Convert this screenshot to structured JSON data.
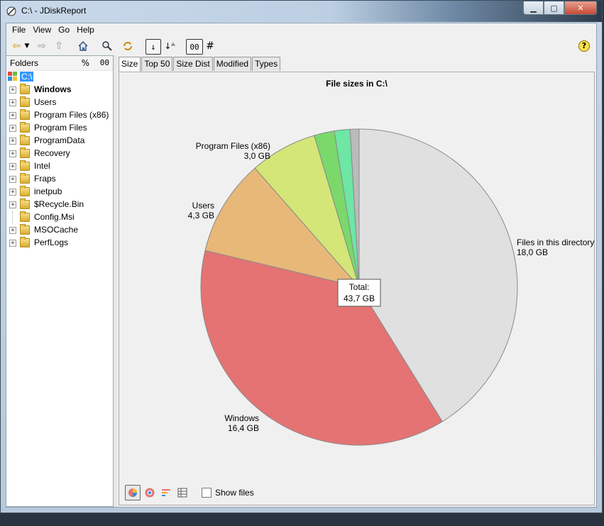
{
  "window": {
    "title": "C:\\ - JDiskReport"
  },
  "menu": [
    "File",
    "View",
    "Go",
    "Help"
  ],
  "toolbar": {
    "mode_label": "00",
    "count_label": "#"
  },
  "folders": {
    "header": "Folders",
    "pct_label": "%",
    "mode_label": "00",
    "root": "C:\\",
    "items": [
      {
        "label": "Windows",
        "bold": true,
        "expandable": true
      },
      {
        "label": "Users",
        "bold": false,
        "expandable": true
      },
      {
        "label": "Program Files (x86)",
        "bold": false,
        "expandable": true
      },
      {
        "label": "Program Files",
        "bold": false,
        "expandable": true
      },
      {
        "label": "ProgramData",
        "bold": false,
        "expandable": true
      },
      {
        "label": "Recovery",
        "bold": false,
        "expandable": true
      },
      {
        "label": "Intel",
        "bold": false,
        "expandable": true
      },
      {
        "label": "Fraps",
        "bold": false,
        "expandable": true
      },
      {
        "label": "inetpub",
        "bold": false,
        "expandable": true
      },
      {
        "label": "$Recycle.Bin",
        "bold": false,
        "expandable": true
      },
      {
        "label": "Config.Msi",
        "bold": false,
        "expandable": false
      },
      {
        "label": "MSOCache",
        "bold": false,
        "expandable": true
      },
      {
        "label": "PerfLogs",
        "bold": false,
        "expandable": true
      }
    ]
  },
  "tabs": [
    "Size",
    "Top 50",
    "Size Dist",
    "Modified",
    "Types"
  ],
  "active_tab": "Size",
  "bottom": {
    "show_files_label": "Show files",
    "show_files_checked": false
  },
  "chart_data": {
    "type": "pie",
    "title": "File sizes in C:\\",
    "total_label": "Total:",
    "total_value": "43,7 GB",
    "slices": [
      {
        "name": "Files in this directory",
        "value": 18.0,
        "value_label": "18,0 GB",
        "color": "#e0e0e0",
        "labeled": true
      },
      {
        "name": "Windows",
        "value": 16.4,
        "value_label": "16,4 GB",
        "color": "#e57373",
        "labeled": true
      },
      {
        "name": "Users",
        "value": 4.3,
        "value_label": "4,3 GB",
        "color": "#e8b878",
        "labeled": true
      },
      {
        "name": "Program Files (x86)",
        "value": 3.0,
        "value_label": "3,0 GB",
        "color": "#d4e678",
        "labeled": true
      },
      {
        "name": "",
        "value": 0.9,
        "value_label": "",
        "color": "#7ad96a",
        "labeled": false
      },
      {
        "name": "",
        "value": 0.7,
        "value_label": "",
        "color": "#6ee6a4",
        "labeled": false
      },
      {
        "name": "",
        "value": 0.4,
        "value_label": "",
        "color": "#bbbbbb",
        "labeled": false
      }
    ]
  }
}
